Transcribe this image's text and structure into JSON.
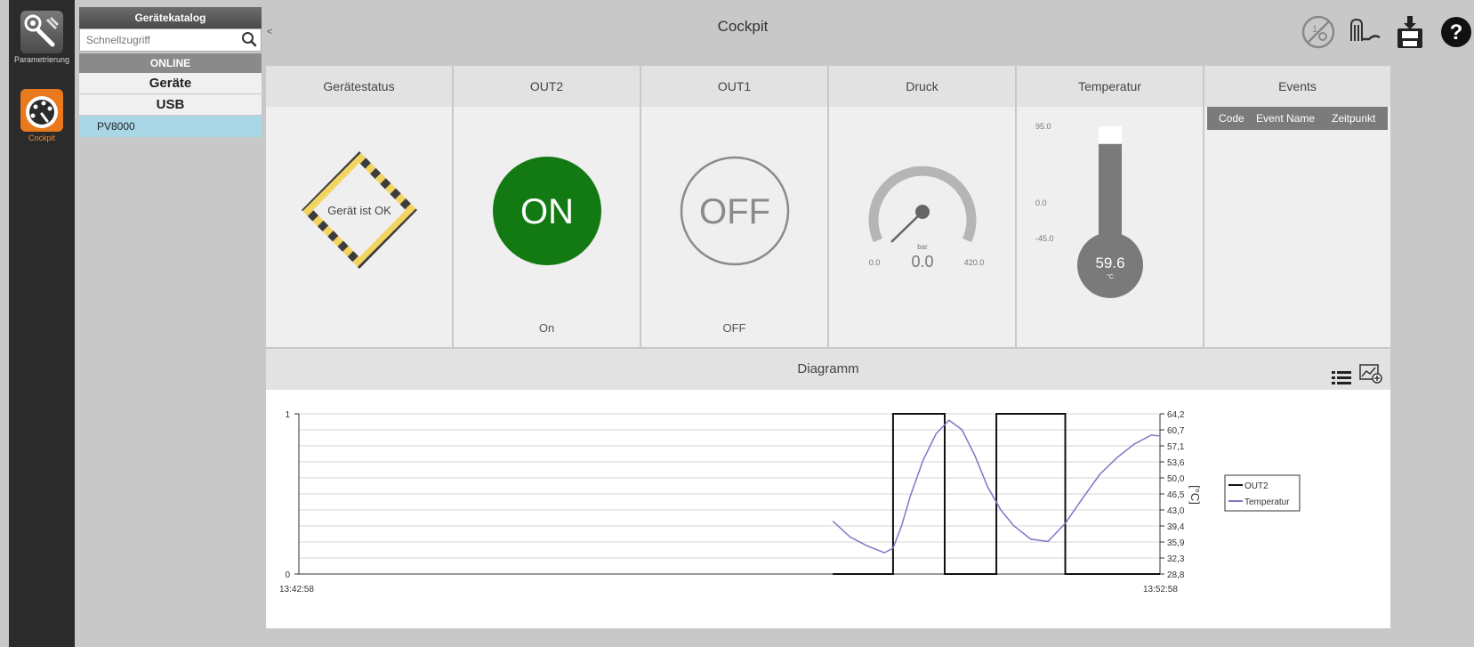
{
  "sidebar": {
    "items": [
      {
        "label": "Parametrierung",
        "icon": "parametrization-icon"
      },
      {
        "label": "Cockpit",
        "icon": "gauge-icon",
        "active": true
      }
    ]
  },
  "catalog": {
    "title": "Gerätekatalog",
    "search_placeholder": "Schnellzugriff",
    "online_label": "ONLINE",
    "groups": [
      "Geräte",
      "USB"
    ],
    "device": "PV8000"
  },
  "header": {
    "collapse": "<",
    "title": "Cockpit",
    "icons": [
      "io-disabled-icon",
      "signal-icon",
      "save-device-icon",
      "help-icon"
    ]
  },
  "tiles": {
    "status": {
      "title": "Gerätestatus",
      "message": "Gerät ist OK"
    },
    "out2": {
      "title": "OUT2",
      "badge": "ON",
      "state": "On",
      "color": "#137a13"
    },
    "out1": {
      "title": "OUT1",
      "badge": "OFF",
      "state": "OFF"
    },
    "pressure": {
      "title": "Druck",
      "unit": "bar",
      "value": "0.0",
      "min": "0.0",
      "max": "420.0"
    },
    "temperature": {
      "title": "Temperatur",
      "scale_max": "95.0",
      "scale_mid": "0.0",
      "scale_min": "-45.0",
      "value": "59.6",
      "unit": "°C",
      "level": 0.87
    },
    "events": {
      "title": "Events",
      "columns": [
        "Code",
        "Event Name",
        "Zeitpunkt"
      ]
    }
  },
  "diagram": {
    "title": "Diagramm",
    "icons": [
      "list-icon",
      "add-chart-icon"
    ]
  },
  "chart_data": {
    "type": "line",
    "x_start": "13:42:58",
    "x_end": "13:52:58",
    "xlabel": "",
    "left_axis": {
      "ticks": [
        "0",
        "1"
      ],
      "ylim": [
        0,
        1
      ]
    },
    "right_axis": {
      "label": "[°C]",
      "ticks": [
        "28,8",
        "32,3",
        "35,9",
        "39,4",
        "43,0",
        "46,5",
        "50,0",
        "53,6",
        "57,1",
        "60,7",
        "64,2"
      ],
      "ylim": [
        28.8,
        64.2
      ]
    },
    "legend": {
      "position": "right",
      "entries": [
        "OUT2",
        "Temperatur"
      ]
    },
    "grid": true,
    "series": [
      {
        "name": "OUT2",
        "color": "#111111",
        "x_minutes": [
          6.2,
          6.9,
          6.9,
          7.5,
          7.5,
          8.1,
          8.1,
          8.9,
          8.9,
          10.0
        ],
        "values": [
          0,
          0,
          1,
          1,
          0,
          0,
          1,
          1,
          0,
          0
        ]
      },
      {
        "name": "Temperatur",
        "color": "#7b78c6",
        "x_minutes": [
          6.2,
          6.4,
          6.6,
          6.8,
          6.9,
          7.0,
          7.1,
          7.25,
          7.4,
          7.55,
          7.7,
          7.85,
          8.0,
          8.15,
          8.3,
          8.5,
          8.7,
          8.9,
          9.1,
          9.3,
          9.5,
          9.7,
          9.9,
          10.0
        ],
        "values": [
          40.5,
          37.0,
          35.0,
          33.5,
          34.5,
          39.5,
          46.0,
          54.0,
          59.8,
          62.8,
          60.7,
          55.0,
          48.0,
          43.0,
          39.5,
          36.5,
          36.0,
          40.0,
          45.5,
          50.8,
          54.5,
          57.5,
          59.5,
          59.3
        ]
      }
    ]
  }
}
